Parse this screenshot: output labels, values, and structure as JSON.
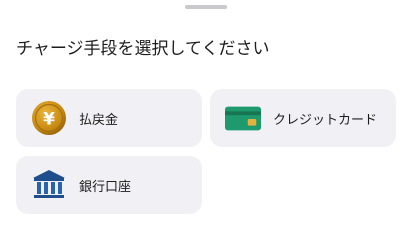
{
  "sheet": {
    "title": "チャージ手段を選択してください"
  },
  "options": [
    {
      "label": "払戻金",
      "icon": "yen-coin-icon"
    },
    {
      "label": "クレジットカード",
      "icon": "credit-card-icon"
    },
    {
      "label": "銀行口座",
      "icon": "bank-icon"
    }
  ],
  "colors": {
    "option_background": "#f1f1f5",
    "coin": "#c88a12",
    "card": "#1e9a6e",
    "bank": "#1f4e8c"
  }
}
